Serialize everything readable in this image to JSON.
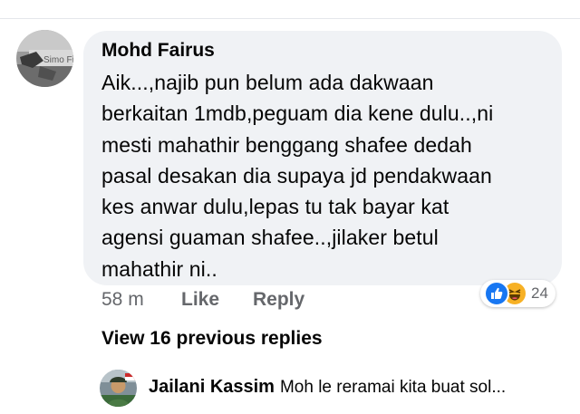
{
  "comment": {
    "author": "Mohd Fairus",
    "avatar_icon": "profile-photo-avatar",
    "text_lines": [
      "Aik...,najib pun belum ada dakwaan",
      "berkaitan 1mdb,peguam dia kene dulu..,ni",
      "mesti mahathir benggang shafee dedah",
      "pasal desakan dia supaya jd pendakwaan",
      "kes anwar dulu,lepas tu tak bayar kat",
      "agensi guaman shafee..,jilaker betul",
      "mahathir ni.."
    ],
    "time": "58 m",
    "like_label": "Like",
    "reply_label": "Reply",
    "reactions": {
      "icons": [
        "like-icon",
        "haha-icon"
      ],
      "count": "24",
      "like_color": "#1877f2",
      "haha_color": "#f7b125"
    }
  },
  "view_previous_replies": "View 16 previous replies",
  "reply_preview": {
    "author": "Jailani Kassim",
    "text": "Moh le reramai kita buat sol...",
    "avatar_icon": "profile-photo-avatar"
  },
  "colors": {
    "bubble_bg": "#f0f2f5",
    "text_primary": "#050505",
    "text_secondary": "#65676b"
  }
}
